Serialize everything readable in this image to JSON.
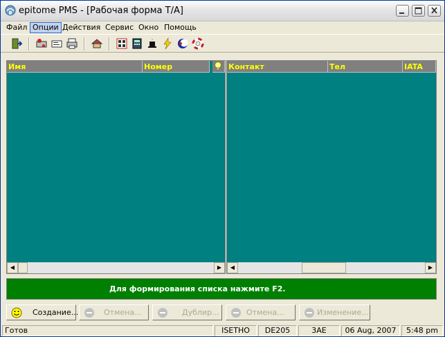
{
  "window": {
    "title": "epitome PMS - [Рабочая форма Т/А]"
  },
  "menu": [
    "Файл",
    "Опции",
    "Действия",
    "Сервис",
    "Окно",
    "Помощь"
  ],
  "toolbar": {
    "icons": [
      "exit-door-icon",
      "print-setup-icon",
      "fax-icon",
      "printer-icon",
      "house-icon",
      "phone-icon",
      "calculator-icon",
      "magic-hat-icon",
      "lightning-icon",
      "moon-icon",
      "lifebuoy-icon"
    ]
  },
  "left_table": {
    "columns": [
      "Имя",
      "Номер"
    ]
  },
  "right_table": {
    "columns": [
      "Контакт",
      "Тел",
      "IATA"
    ]
  },
  "banner": {
    "text": "Для формирования списка нажмите F2."
  },
  "buttons": {
    "create": "Создание...",
    "cancel1": "Отмена...",
    "duplicate": "Дублир...",
    "cancel2": "Отмена...",
    "change": "Изменение..."
  },
  "status": {
    "state": "Готов",
    "user": "ISETHO",
    "terminal": "DE205",
    "code": "3AE",
    "date": "06 Aug, 2007",
    "time": "5:48 pm"
  },
  "colors": {
    "grid_bg": "#008080",
    "header_bg": "#808080",
    "header_text": "#ffff00",
    "banner_bg": "#008000"
  }
}
